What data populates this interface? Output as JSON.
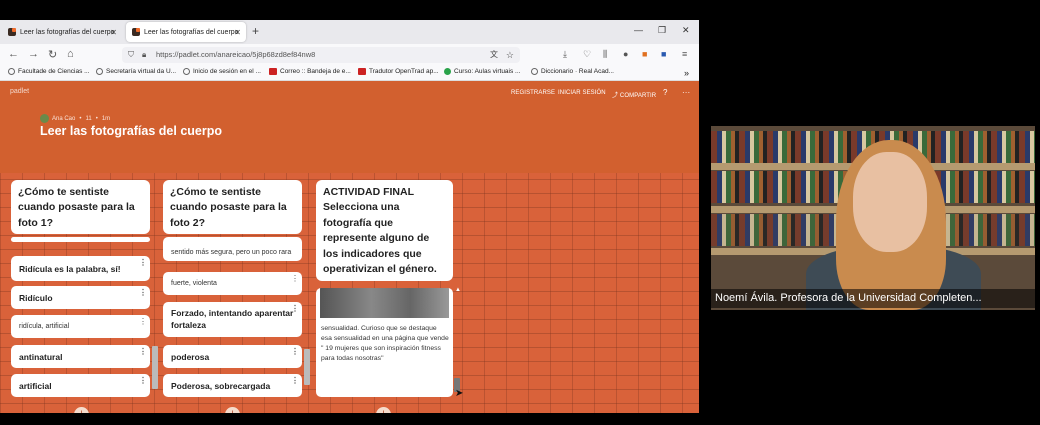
{
  "browser": {
    "tabs": [
      {
        "label": "Leer las fotografías del cuerpo"
      },
      {
        "label": "Leer las fotografías del cuerpo"
      }
    ],
    "url": "https://padlet.com/anareicao/5j8p68zd8ef84nw8",
    "bookmarks": [
      "Facultade de Ciencias ...",
      "Secretaría virtual da U...",
      "Inicio de sesión en el ...",
      "Correo :: Bandeja de e...",
      "Tradutor OpenTrad ap...",
      "Curso: Aulas virtuais ...",
      "Diccionario · Real Acad..."
    ]
  },
  "padlet": {
    "logo": "padlet",
    "links": {
      "register": "REGISTRARSE",
      "login": "INICIAR SESIÓN",
      "share": "COMPARTIR",
      "help": "?",
      "more": "···"
    },
    "author": "Ana Cao",
    "likes": "11",
    "time": "1m",
    "title": "Leer las fotografías del cuerpo",
    "columns": [
      {
        "title": "¿Cómo te sentiste cuando posaste para la foto 1?",
        "cards": [
          "Ridícula es la palabra, sí!",
          "Ridículo",
          "ridícula, artificial",
          "antinatural",
          "artificial"
        ]
      },
      {
        "title": "¿Cómo te sentiste cuando posaste para la foto 2?",
        "partial": "sentido más segura, pero un poco rara",
        "cards": [
          "fuerte, violenta",
          "Forzado, intentando aparentar fortaleza",
          "poderosa",
          "Poderosa, sobrecargada"
        ]
      },
      {
        "title": "ACTIVIDAD FINAL Selecciona una fotografía que represente alguno de los indicadores que operativizan el género.",
        "card_text": "sensualidad. Curioso que se destaque esa sensualidad en una página que vende \" 19 mujeres que son inspiración fitness para todas nosotras\""
      }
    ],
    "add": "+"
  },
  "video": {
    "caption": "Noemí Ávila. Profesora de la Universidad Completen..."
  }
}
